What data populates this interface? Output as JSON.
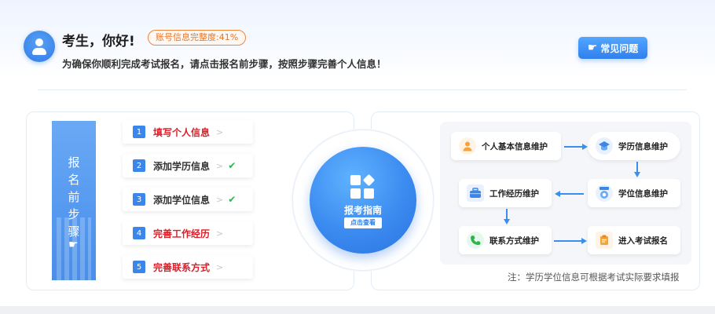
{
  "header": {
    "greeting": "考生，你好!",
    "completeness_badge": "账号信息完整度:41%",
    "subtitle": "为确保你顺利完成考试报名，请点击报名前步骤，按照步骤完善个人信息！",
    "faq_label": "常见问题",
    "faq_icon": "hand-pointer-icon"
  },
  "sidebar_banner": {
    "chars": [
      "报",
      "名",
      "前",
      "步",
      "骤"
    ],
    "icon": "hand-pointer-icon"
  },
  "steps": [
    {
      "num": "1",
      "label": "填写个人信息",
      "color": "#d9202b",
      "done": false
    },
    {
      "num": "2",
      "label": "添加学历信息",
      "color": "#333333",
      "done": true
    },
    {
      "num": "3",
      "label": "添加学位信息",
      "color": "#333333",
      "done": true
    },
    {
      "num": "4",
      "label": "完善工作经历",
      "color": "#d9202b",
      "done": false
    },
    {
      "num": "5",
      "label": "完善联系方式",
      "color": "#d9202b",
      "done": false
    }
  ],
  "guide": {
    "title": "报考指南",
    "button": "点击查看"
  },
  "flow": {
    "nodes": [
      {
        "label": "个人基本信息维护",
        "icon": "person-icon"
      },
      {
        "label": "学历信息维护",
        "icon": "graduation-cap-icon"
      },
      {
        "label": "学位信息维护",
        "icon": "medal-icon"
      },
      {
        "label": "工作经历维护",
        "icon": "briefcase-icon"
      },
      {
        "label": "联系方式维护",
        "icon": "phone-icon"
      },
      {
        "label": "进入考试报名",
        "icon": "clipboard-icon"
      }
    ],
    "note": "注：学历学位信息可根据考试实际要求填报"
  },
  "colors": {
    "accent": "#3b86ea",
    "warning": "#d9202b",
    "badge": "#ee7322",
    "success": "#2bb54a"
  }
}
